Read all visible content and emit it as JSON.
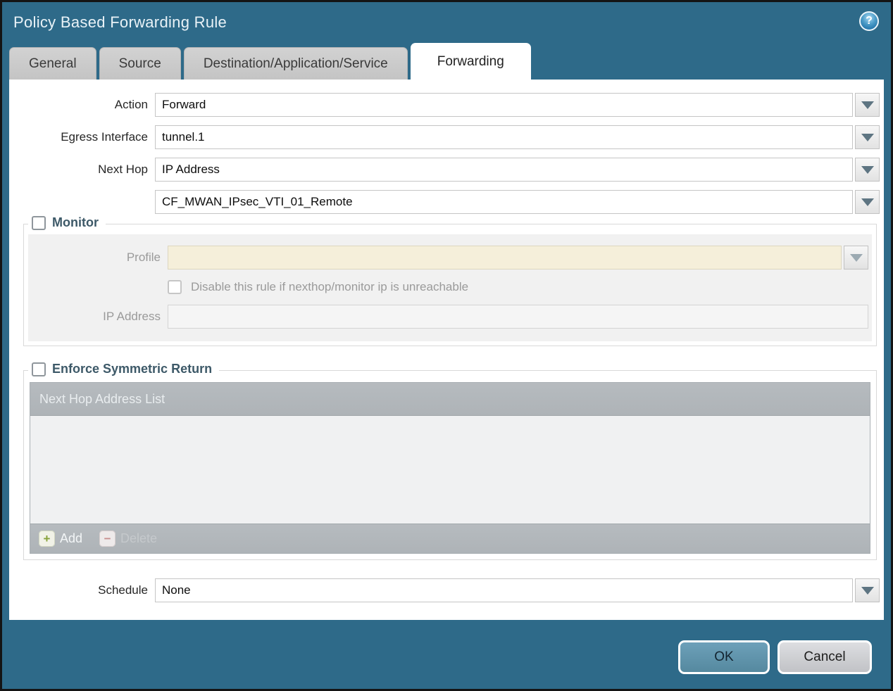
{
  "window": {
    "title": "Policy Based Forwarding Rule"
  },
  "icons": {
    "help": "?",
    "add": "+",
    "delete": "−"
  },
  "tabs": [
    {
      "label": "General",
      "active": false
    },
    {
      "label": "Source",
      "active": false
    },
    {
      "label": "Destination/Application/Service",
      "active": false
    },
    {
      "label": "Forwarding",
      "active": true
    }
  ],
  "form": {
    "action_label": "Action",
    "action_value": "Forward",
    "egress_label": "Egress Interface",
    "egress_value": "tunnel.1",
    "next_hop_label": "Next Hop",
    "next_hop_value": "IP Address",
    "next_hop_address_value": "CF_MWAN_IPsec_VTI_01_Remote",
    "schedule_label": "Schedule",
    "schedule_value": "None"
  },
  "monitor": {
    "legend": "Monitor",
    "checked": false,
    "profile_label": "Profile",
    "profile_value": "",
    "disable_label": "Disable this rule if nexthop/monitor ip is unreachable",
    "disable_checked": false,
    "ip_label": "IP Address",
    "ip_value": ""
  },
  "symmetric_return": {
    "legend": "Enforce Symmetric Return",
    "checked": false,
    "table_header": "Next Hop Address List",
    "add_label": "Add",
    "delete_label": "Delete"
  },
  "footer": {
    "ok_label": "OK",
    "cancel_label": "Cancel"
  },
  "colors": {
    "dialog_bg": "#2e6a89",
    "active_tab_bg": "#ffffff",
    "inactive_tab_bg": "#c9c9c9",
    "ok_button": "#5d92ad",
    "cancel_button": "#cdced1",
    "profile_disabled_bg": "#f5efda",
    "table_chrome": "#b2b7bb",
    "legend_text": "#3d5968",
    "add_plus": "#87a23a",
    "delete_minus": "#c9908f"
  }
}
